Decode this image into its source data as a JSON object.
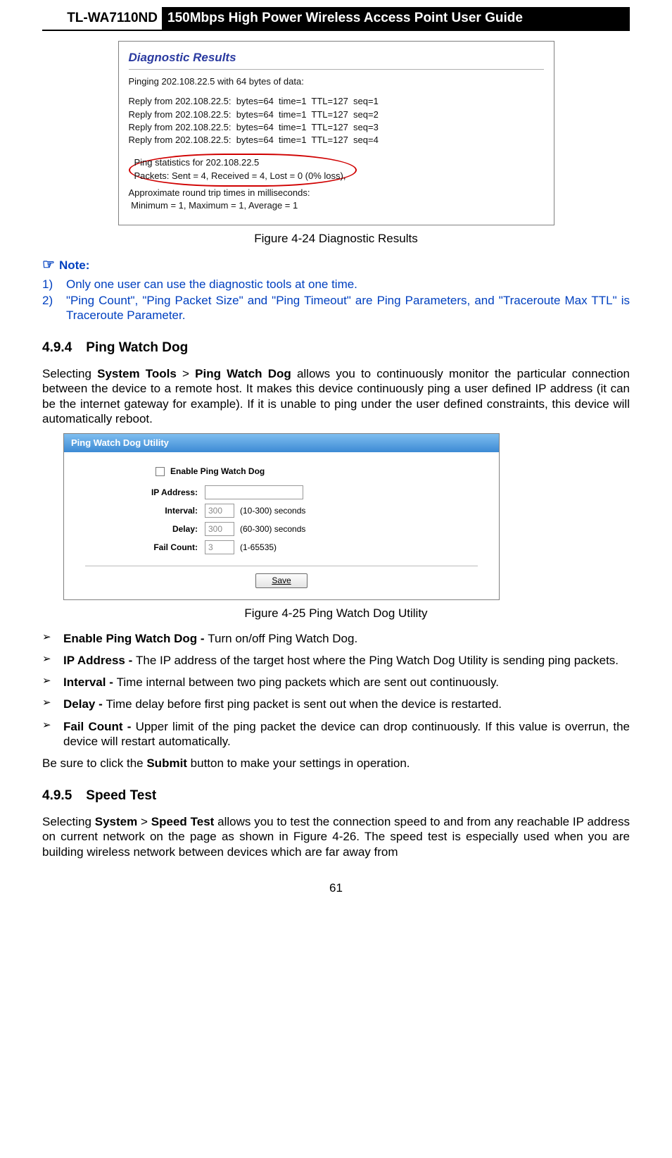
{
  "header": {
    "model": "TL-WA7110ND",
    "title": "150Mbps High Power Wireless Access Point User Guide"
  },
  "diagnostic_box": {
    "title": "Diagnostic Results",
    "line_ping": "Pinging 202.108.22.5 with 64 bytes of data:",
    "replies": [
      "Reply from 202.108.22.5:  bytes=64  time=1  TTL=127  seq=1",
      "Reply from 202.108.22.5:  bytes=64  time=1  TTL=127  seq=2",
      "Reply from 202.108.22.5:  bytes=64  time=1  TTL=127  seq=3",
      "Reply from 202.108.22.5:  bytes=64  time=1  TTL=127  seq=4"
    ],
    "stats_l1": "Ping statistics for 202.108.22.5",
    "stats_l2": "Packets: Sent = 4, Received = 4, Lost = 0 (0% loss),",
    "round_l1": "Approximate round trip times in milliseconds:",
    "round_l2": " Minimum = 1, Maximum = 1, Average = 1",
    "caption": "Figure 4-24 Diagnostic Results"
  },
  "note": {
    "header": "Note:",
    "items": [
      "Only one user can use the diagnostic tools at one time.",
      "\"Ping Count\", \"Ping Packet Size\" and \"Ping Timeout\" are Ping Parameters, and \"Traceroute Max TTL\" is Traceroute Parameter."
    ]
  },
  "section_494": {
    "number": "4.9.4",
    "title": "Ping Watch Dog",
    "para_pre": "Selecting ",
    "para_bold1": "System Tools",
    "para_gt": " > ",
    "para_bold2": "Ping Watch Dog",
    "para_rest": " allows you to continuously  monitor the particular connection between the device to a remote host. It makes this device continuously ping a user defined IP address (it can be the internet gateway for example). If it is unable to ping under the user defined constraints, this device will automatically reboot."
  },
  "pwd_box": {
    "titlebar": "Ping Watch Dog Utility",
    "checkbox_label": "Enable Ping Watch Dog",
    "fields": {
      "ip_label": "IP Address:",
      "ip_value": "",
      "interval_label": "Interval:",
      "interval_value": "300",
      "interval_hint": "(10-300) seconds",
      "delay_label": "Delay:",
      "delay_value": "300",
      "delay_hint": "(60-300) seconds",
      "fail_label": "Fail Count:",
      "fail_value": "3",
      "fail_hint": "(1-65535)"
    },
    "save": "Save",
    "caption": "Figure 4-25 Ping Watch Dog Utility"
  },
  "bullets": [
    {
      "bold": "Enable Ping Watch Dog - ",
      "rest": "Turn on/off Ping Watch Dog."
    },
    {
      "bold": "IP Address - ",
      "rest": "The IP address of the target host where the Ping Watch Dog Utility is sending ping packets."
    },
    {
      "bold": "Interval - ",
      "rest": "Time internal between two ping packets which are sent out continuously."
    },
    {
      "bold": "Delay - ",
      "rest": "Time delay before first ping packet is sent out when the device is restarted."
    },
    {
      "bold": "Fail Count - ",
      "rest": "Upper limit of the ping packet the device can drop continuously. If this value is overrun, the device will restart automatically."
    }
  ],
  "submit_line_pre": "Be sure to click the ",
  "submit_line_bold": "Submit",
  "submit_line_post": " button to make your settings in operation.",
  "section_495": {
    "number": "4.9.5",
    "title": "Speed Test",
    "para_pre": "Selecting ",
    "para_bold1": "System",
    "para_gt": " > ",
    "para_bold2": "Speed Test",
    "para_rest": " allows you to test the connection speed to and  from  any reachable IP address on current network on the page as shown in Figure 4-26. The speed test is especially used when you are building wireless network between devices which are far away from"
  },
  "page_number": "61"
}
